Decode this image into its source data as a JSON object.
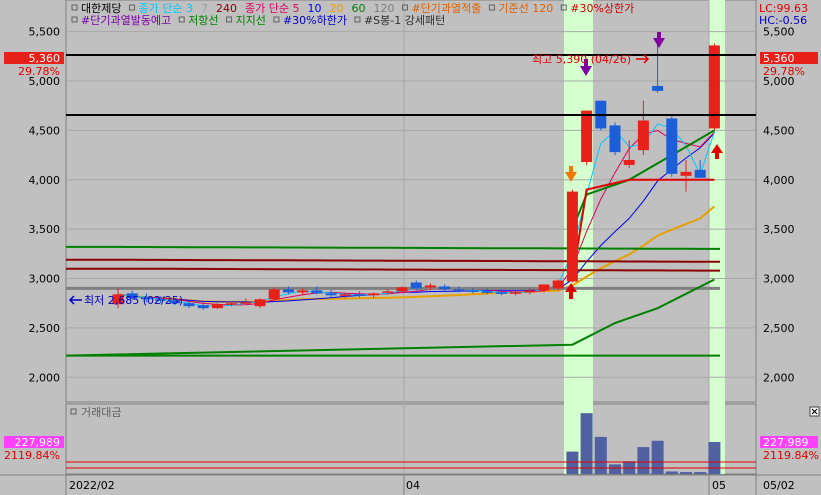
{
  "legend_row1": [
    {
      "text": "대한제당",
      "color": "#000000",
      "type": "label"
    },
    {
      "text": "종가 단순 3",
      "color": "#00c8ff",
      "type": "ma"
    },
    {
      "text": "7",
      "color": "#a0a0a0",
      "type": "ma"
    },
    {
      "text": "240",
      "color": "#8b0000",
      "type": "ma"
    },
    {
      "text": "종가 단순 5",
      "color": "#e00060",
      "type": "ma"
    },
    {
      "text": "10",
      "color": "#0000ff",
      "type": "ma"
    },
    {
      "text": "20",
      "color": "#e8a000",
      "type": "ma"
    },
    {
      "text": "60",
      "color": "#008000",
      "type": "ma"
    },
    {
      "text": "120",
      "color": "#808080",
      "type": "ma"
    },
    {
      "text": "#단기과열적출",
      "color": "#e06000",
      "type": "ind"
    },
    {
      "text": "기준선 120",
      "color": "#e06000",
      "type": "ind"
    },
    {
      "text": "#30%상한가",
      "color": "#d00000",
      "type": "ind"
    }
  ],
  "legend_row2": [
    {
      "text": "#단기과열발동예고",
      "color": "#7b00a8",
      "type": "ind"
    },
    {
      "text": "저항선",
      "color": "#008000",
      "type": "ind"
    },
    {
      "text": "지지선",
      "color": "#008000",
      "type": "ind"
    },
    {
      "text": "#30%하한가",
      "color": "#0000c8",
      "type": "ind"
    },
    {
      "text": "#S봉-1 강세패턴",
      "color": "#303030",
      "type": "ind"
    }
  ],
  "right_top": {
    "lc": "LC:99.63",
    "hc": "HC:-0.56"
  },
  "price_axis": {
    "ticks": [
      "5,500",
      "5,000",
      "4,500",
      "4,000",
      "3,500",
      "3,000",
      "2,500",
      "2,000"
    ],
    "current_price": "5,360",
    "current_pct": "29.78%"
  },
  "annotations": {
    "high": "최고 5,390 (04/26)",
    "low": "최저 2,685 (02/25)"
  },
  "volume": {
    "title": "거래대금",
    "current": "227,989",
    "pct": "2119.84%",
    "close_icon": "close-icon"
  },
  "date_axis": [
    "2022/02",
    "04",
    "05",
    "05/02"
  ],
  "colors": {
    "up": "#e8201a",
    "down": "#1c5ed8",
    "highlight": "#d6ffd0",
    "bg": "#c0c0c0"
  },
  "chart_data": {
    "type": "candlestick",
    "ylim": [
      1750,
      5820
    ],
    "candles": [
      {
        "o": 2740,
        "h": 2900,
        "l": 2700,
        "c": 2840
      },
      {
        "o": 2850,
        "h": 2880,
        "l": 2780,
        "c": 2800
      },
      {
        "o": 2810,
        "h": 2850,
        "l": 2760,
        "c": 2790
      },
      {
        "o": 2790,
        "h": 2820,
        "l": 2750,
        "c": 2780
      },
      {
        "o": 2780,
        "h": 2800,
        "l": 2730,
        "c": 2750
      },
      {
        "o": 2750,
        "h": 2780,
        "l": 2700,
        "c": 2720
      },
      {
        "o": 2730,
        "h": 2760,
        "l": 2685,
        "c": 2700
      },
      {
        "o": 2700,
        "h": 2750,
        "l": 2690,
        "c": 2740
      },
      {
        "o": 2740,
        "h": 2770,
        "l": 2720,
        "c": 2750
      },
      {
        "o": 2760,
        "h": 2800,
        "l": 2740,
        "c": 2760
      },
      {
        "o": 2720,
        "h": 2800,
        "l": 2700,
        "c": 2790
      },
      {
        "o": 2790,
        "h": 2910,
        "l": 2780,
        "c": 2890
      },
      {
        "o": 2890,
        "h": 2920,
        "l": 2840,
        "c": 2860
      },
      {
        "o": 2860,
        "h": 2900,
        "l": 2830,
        "c": 2880
      },
      {
        "o": 2880,
        "h": 2920,
        "l": 2840,
        "c": 2850
      },
      {
        "o": 2850,
        "h": 2880,
        "l": 2800,
        "c": 2830
      },
      {
        "o": 2830,
        "h": 2860,
        "l": 2800,
        "c": 2840
      },
      {
        "o": 2840,
        "h": 2870,
        "l": 2810,
        "c": 2830
      },
      {
        "o": 2830,
        "h": 2860,
        "l": 2800,
        "c": 2850
      },
      {
        "o": 2860,
        "h": 2890,
        "l": 2840,
        "c": 2870
      },
      {
        "o": 2870,
        "h": 2920,
        "l": 2850,
        "c": 2910
      },
      {
        "o": 2960,
        "h": 2980,
        "l": 2880,
        "c": 2900
      },
      {
        "o": 2910,
        "h": 2950,
        "l": 2880,
        "c": 2930
      },
      {
        "o": 2920,
        "h": 2940,
        "l": 2870,
        "c": 2890
      },
      {
        "o": 2890,
        "h": 2920,
        "l": 2860,
        "c": 2880
      },
      {
        "o": 2880,
        "h": 2910,
        "l": 2850,
        "c": 2870
      },
      {
        "o": 2870,
        "h": 2900,
        "l": 2840,
        "c": 2860
      },
      {
        "o": 2860,
        "h": 2890,
        "l": 2830,
        "c": 2850
      },
      {
        "o": 2850,
        "h": 2880,
        "l": 2830,
        "c": 2860
      },
      {
        "o": 2860,
        "h": 2900,
        "l": 2840,
        "c": 2880
      },
      {
        "o": 2880,
        "h": 2930,
        "l": 2860,
        "c": 2940
      },
      {
        "o": 2900,
        "h": 2990,
        "l": 2880,
        "c": 2980
      },
      {
        "o": 2970,
        "h": 3900,
        "l": 2960,
        "c": 3880
      },
      {
        "o": 4180,
        "h": 4700,
        "l": 4150,
        "c": 4700
      },
      {
        "o": 4800,
        "h": 4800,
        "l": 4500,
        "c": 4520
      },
      {
        "o": 4550,
        "h": 4580,
        "l": 4250,
        "c": 4280
      },
      {
        "o": 4150,
        "h": 4400,
        "l": 4120,
        "c": 4200
      },
      {
        "o": 4300,
        "h": 4800,
        "l": 4250,
        "c": 4600
      },
      {
        "o": 4950,
        "h": 5390,
        "l": 4880,
        "c": 4900
      },
      {
        "o": 4620,
        "h": 4650,
        "l": 4030,
        "c": 4060
      },
      {
        "o": 4040,
        "h": 4200,
        "l": 3880,
        "c": 4080
      },
      {
        "o": 4100,
        "h": 4200,
        "l": 4020,
        "c": 4020
      },
      {
        "o": 4520,
        "h": 5380,
        "l": 4500,
        "c": 5360
      }
    ],
    "volume": [
      0,
      0,
      0,
      0,
      0,
      0,
      0,
      0,
      0,
      0,
      0,
      0,
      0,
      0,
      0,
      0,
      0,
      0,
      0,
      0,
      0,
      0,
      0,
      0,
      0,
      0,
      0,
      0,
      0,
      0,
      0,
      0,
      35,
      95,
      58,
      15,
      20,
      42,
      52,
      4,
      3,
      3,
      50
    ]
  }
}
